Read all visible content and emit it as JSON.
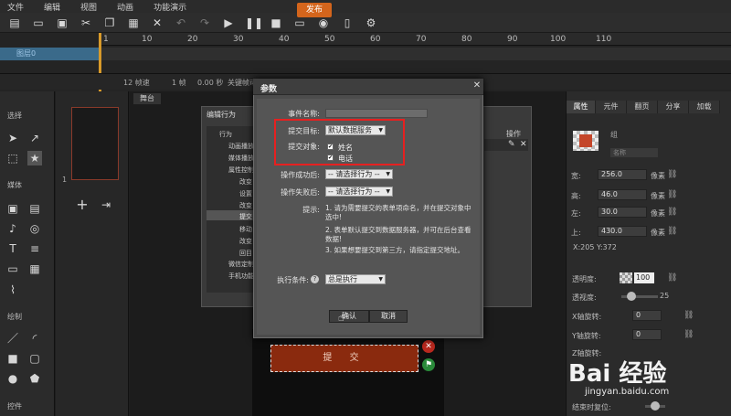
{
  "menubar": {
    "items": [
      "文件",
      "编辑",
      "视图",
      "动画",
      "功能演示"
    ]
  },
  "toolbar": {
    "publish_label": "发布"
  },
  "timeline": {
    "ticks": [
      "1",
      "10",
      "20",
      "30",
      "40",
      "50",
      "60",
      "70",
      "80",
      "90",
      "100",
      "110"
    ],
    "layer_name": "图层0",
    "status": {
      "frame_rate": "12 帧速",
      "frame": "1 帧",
      "time": "0.00 秒",
      "keyframe": "关键帧动"
    }
  },
  "left_panel": {
    "section_select": "选择",
    "section_media": "媒体",
    "section_draw": "绘制",
    "section_controls": "控件"
  },
  "thumbnail": {
    "page_number": "1"
  },
  "stage": {
    "tab_label": "舞台",
    "submit_text": "提 交"
  },
  "behavior_dialog": {
    "title": "编辑行为",
    "tree_root": "行为",
    "tree_items": [
      "动画播放",
      "媒体播放",
      "属性控制",
      "改变",
      "设置",
      "改变",
      "提交",
      "移动",
      "改变",
      "回目"
    ],
    "more_items": [
      "微信定制",
      "手机功能"
    ],
    "column_operation": "操作"
  },
  "param_dialog": {
    "title": "参数",
    "event_name_label": "事件名称:",
    "event_name_value": "",
    "submit_target_label": "提交目标:",
    "submit_target_value": "默认数据服务",
    "submit_object_label": "提交对象:",
    "checkbox_name": "姓名",
    "checkbox_phone": "电话",
    "on_success_label": "操作成功后:",
    "on_success_value": "-- 请选择行为 --",
    "on_fail_label": "操作失败后:",
    "on_fail_value": "-- 请选择行为 --",
    "hint_label": "提示:",
    "hint_1": "1. 请为需要提交的表单项命名，并在提交对象中选中!",
    "hint_2": "2. 表单默认提交到数据服务器，并可在后台查看数据!",
    "hint_3": "3. 如果想要提交到第三方，请指定提交地址。",
    "condition_label": "执行条件:",
    "condition_value": "总是执行",
    "ok_label": "确认",
    "cancel_label": "取消"
  },
  "right_panel": {
    "tabs": [
      "属性",
      "元件",
      "翻页",
      "分享",
      "加载"
    ],
    "component_name": "组",
    "component_sub": "名称",
    "props": [
      {
        "label": "宽:",
        "value": "256.0",
        "unit": "像素"
      },
      {
        "label": "高:",
        "value": "46.0",
        "unit": "像素"
      },
      {
        "label": "左:",
        "value": "30.0",
        "unit": "像素"
      },
      {
        "label": "上:",
        "value": "430.0",
        "unit": "像素"
      }
    ],
    "coords": "X:205   Y:372",
    "opacity_label": "透明度:",
    "opacity_value": "100",
    "blur_label": "透视度:",
    "blur_value": "25",
    "xrot_label": "X轴旋转:",
    "xrot_value": "0",
    "yrot_label": "Y轴旋转:",
    "yrot_value": "0",
    "zrot_label": "Z轴旋转:",
    "reset_label": "结束时复位:"
  },
  "watermark": {
    "logo": "Bai 经验",
    "url": "jingyan.baidu.com"
  }
}
